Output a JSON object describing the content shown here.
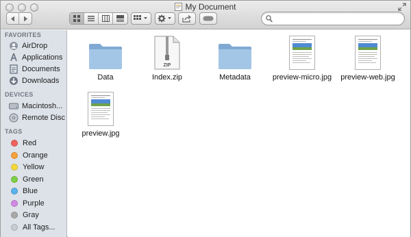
{
  "window": {
    "title": "My Document"
  },
  "toolbar": {
    "back_icon": "back-arrow-icon",
    "forward_icon": "forward-arrow-icon",
    "view_modes": [
      "icon-view-icon",
      "list-view-icon",
      "column-view-icon",
      "cover-flow-icon"
    ],
    "arrange_icon": "arrange-grid-icon",
    "action_icon": "gear-icon",
    "share_icon": "share-icon",
    "tags_icon": "tag-pill-icon",
    "search_placeholder": ""
  },
  "sidebar": {
    "favorites_heading": "FAVORITES",
    "favorites": [
      {
        "label": "AirDrop",
        "icon": "airdrop-icon"
      },
      {
        "label": "Applications",
        "icon": "applications-icon"
      },
      {
        "label": "Documents",
        "icon": "documents-icon"
      },
      {
        "label": "Downloads",
        "icon": "downloads-icon"
      }
    ],
    "devices_heading": "DEVICES",
    "devices": [
      {
        "label": "Macintosh...",
        "icon": "hard-drive-icon"
      },
      {
        "label": "Remote Disc",
        "icon": "disc-icon"
      }
    ],
    "tags_heading": "TAGS",
    "tags": [
      {
        "label": "Red",
        "color": "#f0635f"
      },
      {
        "label": "Orange",
        "color": "#f6a23c"
      },
      {
        "label": "Yellow",
        "color": "#f3d93c"
      },
      {
        "label": "Green",
        "color": "#7fcf45"
      },
      {
        "label": "Blue",
        "color": "#5ab2ea"
      },
      {
        "label": "Purple",
        "color": "#d08ae3"
      },
      {
        "label": "Gray",
        "color": "#a9a9a9"
      },
      {
        "label": "All Tags...",
        "color": "#c8ccd1"
      }
    ]
  },
  "files": [
    {
      "name": "Data",
      "type": "folder"
    },
    {
      "name": "Index.zip",
      "type": "zip",
      "badge": "ZIP"
    },
    {
      "name": "Metadata",
      "type": "folder"
    },
    {
      "name": "preview-micro.jpg",
      "type": "image"
    },
    {
      "name": "preview-web.jpg",
      "type": "image"
    },
    {
      "name": "preview.jpg",
      "type": "image"
    }
  ]
}
